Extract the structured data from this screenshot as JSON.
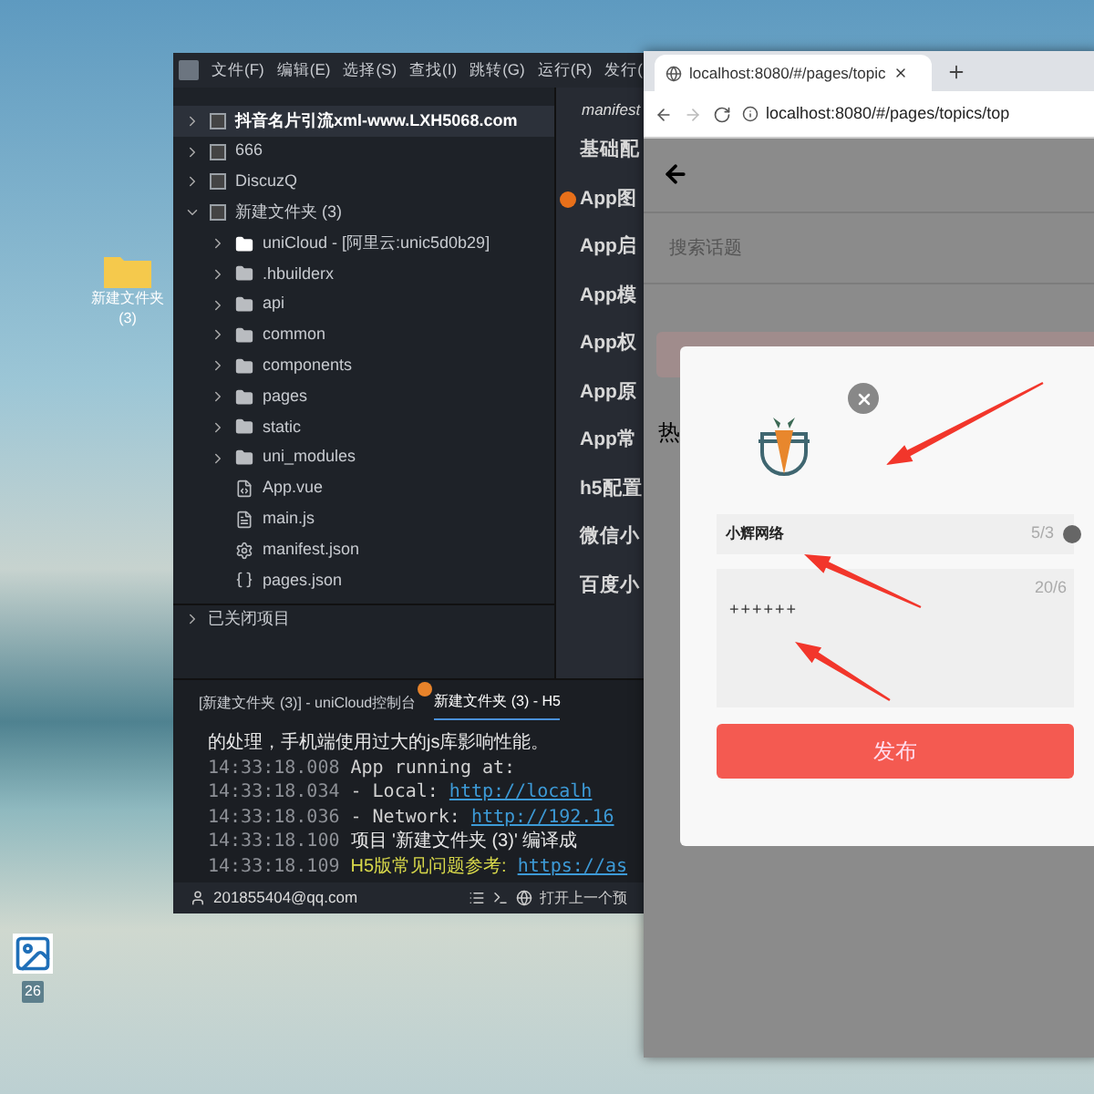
{
  "desktop": {
    "icons": [
      {
        "label": "新建文件夹 (3)",
        "kind": "folder"
      },
      {
        "label": "26",
        "kind": "image"
      }
    ]
  },
  "ide": {
    "menu": [
      "文件(F)",
      "编辑(E)",
      "选择(S)",
      "查找(I)",
      "跳转(G)",
      "运行(R)",
      "发行("
    ],
    "tree": [
      {
        "label": "抖音名片引流xml-www.LXH5068.com",
        "kind": "project",
        "selected": true,
        "expanded": false
      },
      {
        "label": "666",
        "kind": "project",
        "selected": false,
        "expanded": false
      },
      {
        "label": "DiscuzQ",
        "kind": "project",
        "selected": false,
        "expanded": false
      },
      {
        "label": "新建文件夹 (3)",
        "kind": "project",
        "selected": false,
        "expanded": true,
        "children": [
          {
            "label": "uniCloud - [阿里云:unic5d0b29]",
            "kind": "cloud",
            "selected": false,
            "expanded": false
          },
          {
            "label": ".hbuilderx",
            "kind": "folder",
            "selected": false,
            "expanded": false
          },
          {
            "label": "api",
            "kind": "folder",
            "selected": false,
            "expanded": false
          },
          {
            "label": "common",
            "kind": "folder",
            "selected": false,
            "expanded": false
          },
          {
            "label": "components",
            "kind": "folder",
            "selected": false,
            "expanded": false
          },
          {
            "label": "pages",
            "kind": "folder",
            "selected": false,
            "expanded": false
          },
          {
            "label": "static",
            "kind": "folder",
            "selected": false,
            "expanded": false
          },
          {
            "label": "uni_modules",
            "kind": "folder",
            "selected": false,
            "expanded": false
          },
          {
            "label": "App.vue",
            "kind": "vue",
            "selected": false
          },
          {
            "label": "main.js",
            "kind": "js",
            "selected": false
          },
          {
            "label": "manifest.json",
            "kind": "settings",
            "selected": false
          },
          {
            "label": "pages.json",
            "kind": "json",
            "selected": false
          }
        ]
      }
    ],
    "closed_projects": "已关闭项目",
    "editor": {
      "title": "manifest",
      "sections": [
        {
          "label": "基础配",
          "warning": false
        },
        {
          "label": "App图",
          "warning": true
        },
        {
          "label": "App启",
          "warning": false
        },
        {
          "label": "App模",
          "warning": false
        },
        {
          "label": "App权",
          "warning": false
        },
        {
          "label": "App原",
          "warning": false
        },
        {
          "label": "App常",
          "warning": false
        },
        {
          "label": "h5配置",
          "warning": false
        },
        {
          "label": "微信小",
          "warning": false
        },
        {
          "label": "百度小",
          "warning": false
        }
      ]
    },
    "console": {
      "tabs": [
        {
          "label": "[新建文件夹 (3)] - uniCloud控制台",
          "selected": false,
          "badge": true
        },
        {
          "label": "新建文件夹 (3) - H5",
          "selected": true,
          "badge": false
        }
      ],
      "lines": [
        {
          "segments": [
            {
              "text": "的处理，手机端使用过大的js库影响性能。",
              "kind": "plain"
            }
          ]
        },
        {
          "time": "14:33:18.008",
          "segments": [
            {
              "text": "App running at:",
              "kind": "mono"
            }
          ]
        },
        {
          "time": "14:33:18.034",
          "segments": [
            {
              "text": "- Local:",
              "kind": "mono"
            },
            {
              "text": "http://localh",
              "kind": "link"
            }
          ]
        },
        {
          "time": "14:33:18.036",
          "segments": [
            {
              "text": "- Network:",
              "kind": "mono"
            },
            {
              "text": "http://192.16",
              "kind": "link"
            }
          ]
        },
        {
          "time": "14:33:18.100",
          "segments": [
            {
              "text": "项目 '新建文件夹 (3)' 编译成",
              "kind": "plain"
            }
          ]
        },
        {
          "time": "14:33:18.109",
          "segments": [
            {
              "text": "H5版常见问题参考:",
              "kind": "hint"
            },
            {
              "text": "https://as",
              "kind": "link"
            }
          ]
        }
      ]
    },
    "status_bar": {
      "account": "201855404@qq.com",
      "action": "打开上一个预"
    }
  },
  "browser": {
    "tab_title": "localhost:8080/#/pages/topic",
    "address": "localhost:8080/#/pages/topics/top",
    "page": {
      "search_placeholder": "搜索话题",
      "section_title": "热",
      "dialog": {
        "name_field": {
          "value": "小辉网络",
          "counter": "5/3"
        },
        "content_field": {
          "value": "++++++",
          "counter": "20/6"
        },
        "submit": "发布"
      }
    }
  }
}
